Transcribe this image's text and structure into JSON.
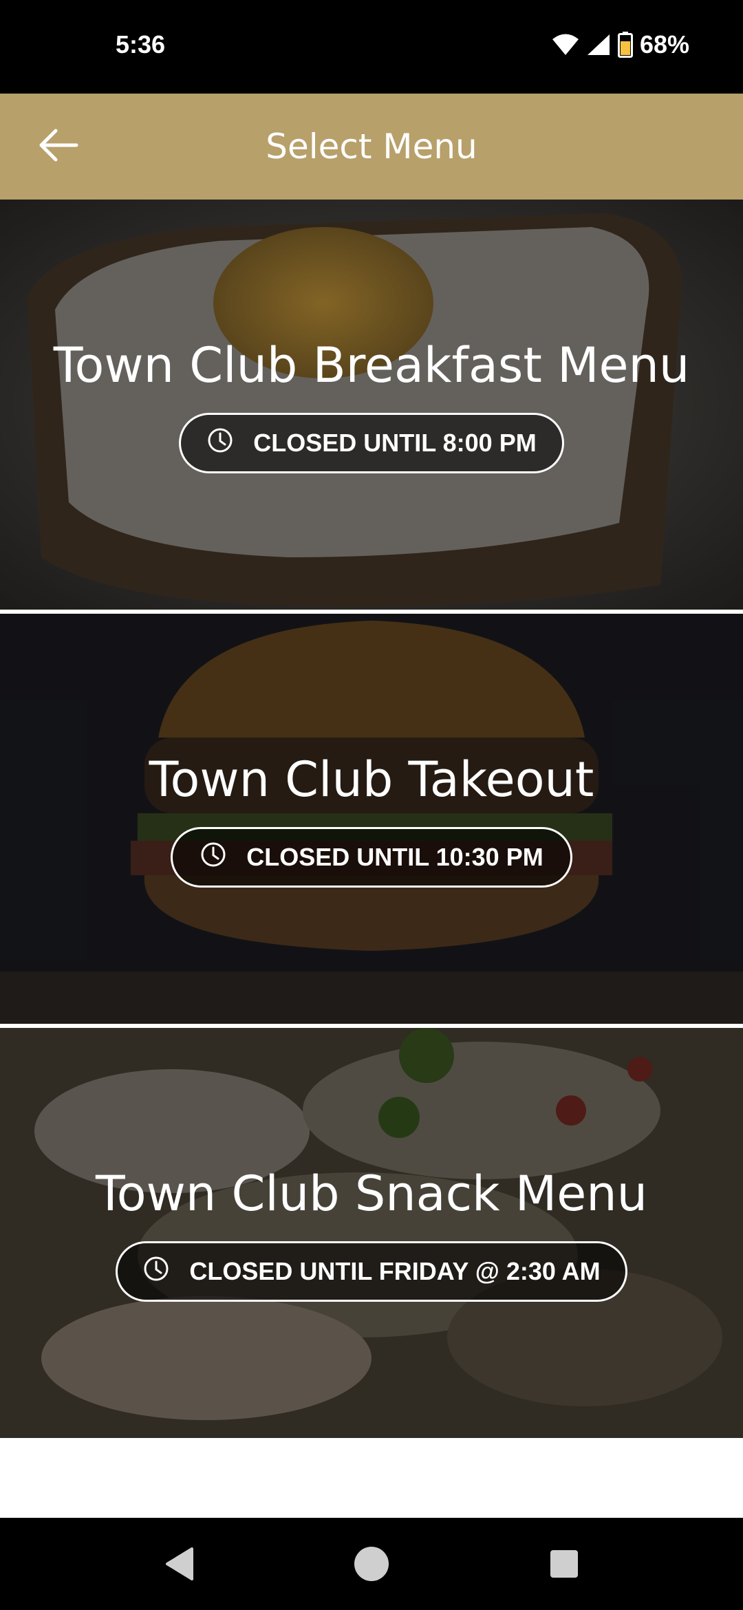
{
  "status_bar": {
    "time": "5:36",
    "battery": "68%",
    "icons": [
      "wifi-icon",
      "cellular-signal-icon",
      "battery-icon"
    ]
  },
  "app_bar": {
    "title": "Select Menu",
    "back_icon": "arrow-left-icon",
    "background_color": "#b8a06b"
  },
  "menus": [
    {
      "title": "Town Club Breakfast Menu",
      "status": "CLOSED UNTIL 8:00 PM",
      "status_icon": "clock-icon"
    },
    {
      "title": "Town Club Takeout",
      "status": "CLOSED UNTIL 10:30 PM",
      "status_icon": "clock-icon"
    },
    {
      "title": "Town Club Snack Menu",
      "status": "CLOSED UNTIL FRIDAY @ 2:30 AM",
      "status_icon": "clock-icon"
    }
  ],
  "nav_bar": {
    "icons": [
      "back-triangle-icon",
      "home-circle-icon",
      "recents-square-icon"
    ]
  }
}
